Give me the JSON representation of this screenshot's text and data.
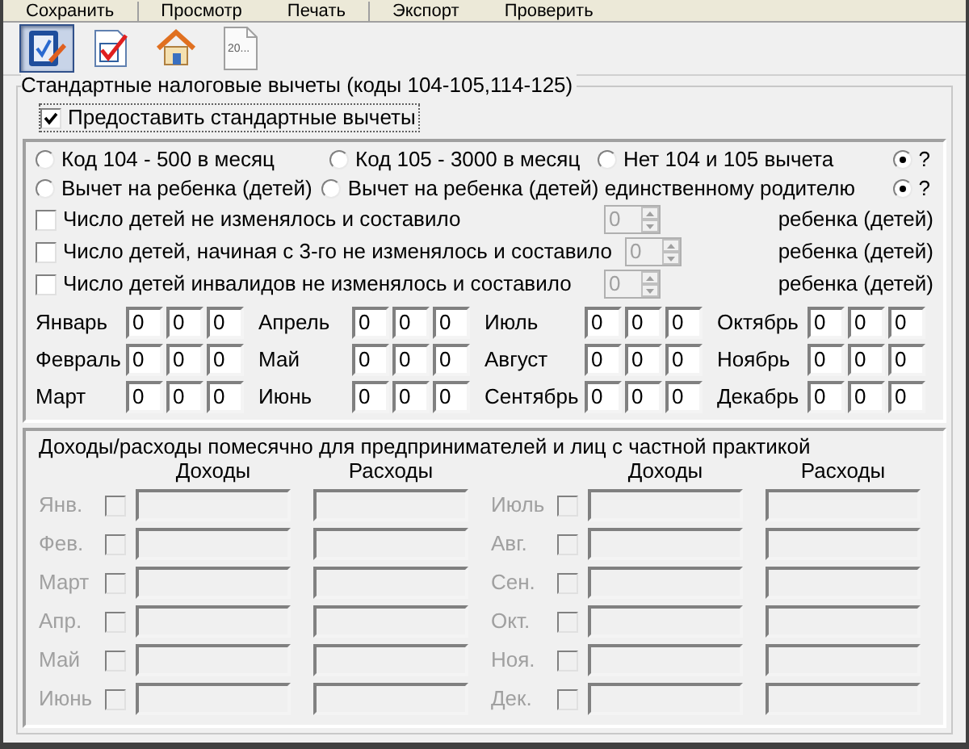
{
  "menu": [
    {
      "label": "Сохранить"
    },
    {
      "label": "Просмотр"
    },
    {
      "label": "Печать"
    },
    {
      "label": "Экспорт"
    },
    {
      "label": "Проверить"
    }
  ],
  "toolbar": [
    {
      "kind": "edit",
      "selected": true
    },
    {
      "kind": "check",
      "selected": false
    },
    {
      "kind": "home",
      "selected": false
    },
    {
      "kind": "page",
      "label": "20...",
      "selected": false
    }
  ],
  "standard": {
    "title": "Стандартные налоговые вычеты (коды 104-105,114-125)",
    "provide": {
      "label": "Предоставить стандартные вычеты",
      "checked": true
    },
    "radio_rows": [
      [
        {
          "label": "Код 104 - 500 в месяц",
          "selected": false
        },
        {
          "label": "Код 105 - 3000 в месяц",
          "selected": false
        },
        {
          "label": "Нет 104 и 105 вычета",
          "selected": false
        },
        {
          "label": "?",
          "selected": true
        }
      ],
      [
        {
          "label": "Вычет на ребенка (детей)",
          "selected": false
        },
        {
          "label": "Вычет на ребенка (детей) единственному родителю",
          "selected": false
        },
        {
          "label": "?",
          "selected": true
        }
      ]
    ],
    "child_rows": [
      {
        "label": "Число детей не изменялось и составило",
        "checked": false,
        "value": "0",
        "disabled": true,
        "unit": "ребенка (детей)"
      },
      {
        "label": "Число детей, начиная с 3-го не изменялось и составило",
        "checked": false,
        "value": "0",
        "disabled": true,
        "unit": "ребенка (детей)"
      },
      {
        "label": "Число детей инвалидов не изменялось и составило",
        "checked": false,
        "value": "0",
        "disabled": true,
        "unit": "ребенка (детей)"
      }
    ],
    "months": [
      {
        "name": "Январь",
        "values": [
          "0",
          "0",
          "0"
        ]
      },
      {
        "name": "Апрель",
        "values": [
          "0",
          "0",
          "0"
        ]
      },
      {
        "name": "Июль",
        "values": [
          "0",
          "0",
          "0"
        ]
      },
      {
        "name": "Октябрь",
        "values": [
          "0",
          "0",
          "0"
        ]
      },
      {
        "name": "Февраль",
        "values": [
          "0",
          "0",
          "0"
        ]
      },
      {
        "name": "Май",
        "values": [
          "0",
          "0",
          "0"
        ]
      },
      {
        "name": "Август",
        "values": [
          "0",
          "0",
          "0"
        ]
      },
      {
        "name": "Ноябрь",
        "values": [
          "0",
          "0",
          "0"
        ]
      },
      {
        "name": "Март",
        "values": [
          "0",
          "0",
          "0"
        ]
      },
      {
        "name": "Июнь",
        "values": [
          "0",
          "0",
          "0"
        ]
      },
      {
        "name": "Сентябрь",
        "values": [
          "0",
          "0",
          "0"
        ]
      },
      {
        "name": "Декабрь",
        "values": [
          "0",
          "0",
          "0"
        ]
      }
    ]
  },
  "income": {
    "title": "Доходы/расходы помесячно для предпринимателей и лиц с частной практикой",
    "headers": [
      "Доходы",
      "Расходы",
      "Доходы",
      "Расходы"
    ],
    "months": [
      {
        "name": "Янв.",
        "checked": false,
        "disabled": true
      },
      {
        "name": "Июль",
        "checked": false,
        "disabled": true
      },
      {
        "name": "Фев.",
        "checked": false,
        "disabled": true
      },
      {
        "name": "Авг.",
        "checked": false,
        "disabled": true
      },
      {
        "name": "Март",
        "checked": false,
        "disabled": true
      },
      {
        "name": "Сен.",
        "checked": false,
        "disabled": true
      },
      {
        "name": "Апр.",
        "checked": false,
        "disabled": true
      },
      {
        "name": "Окт.",
        "checked": false,
        "disabled": true
      },
      {
        "name": "Май",
        "checked": false,
        "disabled": true
      },
      {
        "name": "Ноя.",
        "checked": false,
        "disabled": true
      },
      {
        "name": "Июнь",
        "checked": false,
        "disabled": true
      },
      {
        "name": "Дек.",
        "checked": false,
        "disabled": true
      }
    ]
  }
}
